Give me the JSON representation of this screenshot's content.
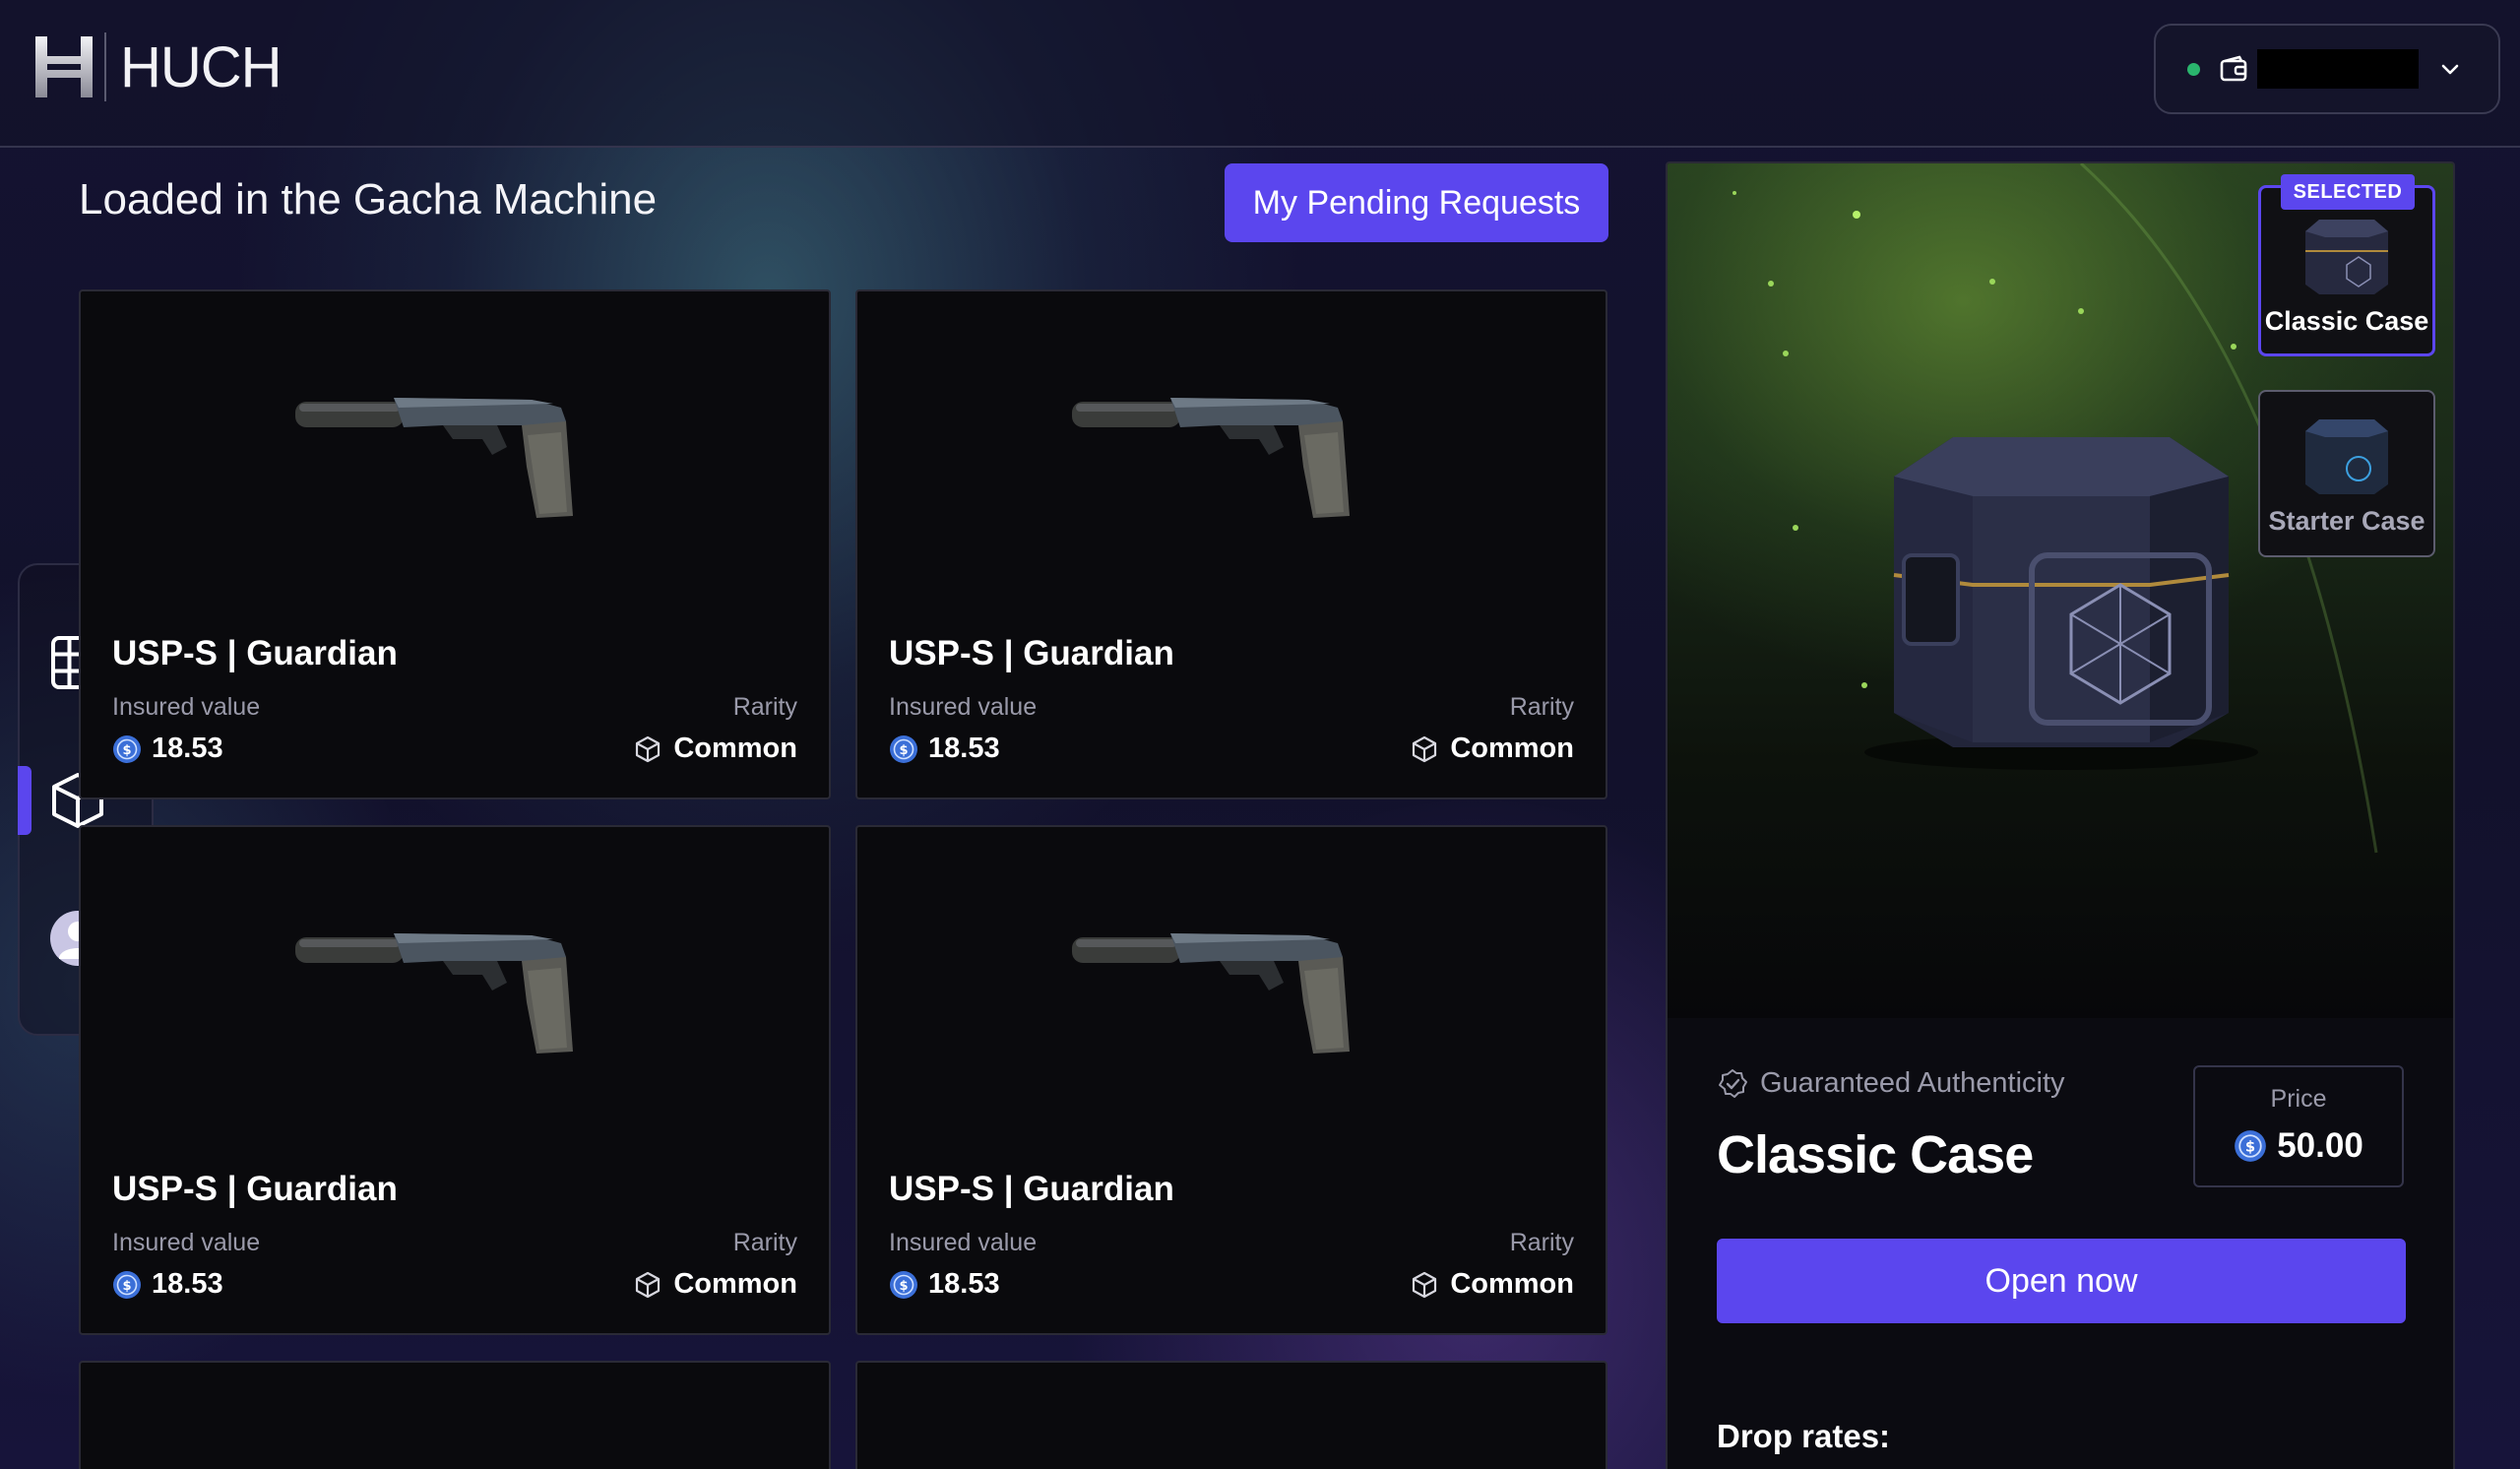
{
  "header": {
    "logo_text": "HUCH",
    "wallet": {
      "status_color": "#2ab56d",
      "address_redacted": true
    }
  },
  "nav": {
    "items": [
      {
        "icon": "grid-icon"
      },
      {
        "icon": "cube-icon",
        "active": true
      },
      {
        "icon": "user-icon"
      }
    ]
  },
  "main": {
    "title": "Loaded in the Gacha Machine",
    "pending_button": "My Pending Requests",
    "cards": [
      {
        "name": "USP-S | Guardian",
        "insured_label": "Insured value",
        "value": "18.53",
        "rarity_label": "Rarity",
        "rarity": "Common"
      },
      {
        "name": "USP-S | Guardian",
        "insured_label": "Insured value",
        "value": "18.53",
        "rarity_label": "Rarity",
        "rarity": "Common"
      },
      {
        "name": "USP-S | Guardian",
        "insured_label": "Insured value",
        "value": "18.53",
        "rarity_label": "Rarity",
        "rarity": "Common"
      },
      {
        "name": "USP-S | Guardian",
        "insured_label": "Insured value",
        "value": "18.53",
        "rarity_label": "Rarity",
        "rarity": "Common"
      }
    ]
  },
  "panel": {
    "cases": [
      {
        "name": "Classic Case",
        "selected": true,
        "badge": "SELECTED"
      },
      {
        "name": "Starter Case",
        "selected": false
      }
    ],
    "authenticity": "Guaranteed Authenticity",
    "case_name": "Classic Case",
    "price_label": "Price",
    "price": "50.00",
    "open_button": "Open now",
    "drop_rates_label": "Drop rates:"
  },
  "colors": {
    "accent": "#5b46ee",
    "coin": "#3b6fd8",
    "muted_text": "#9a9aaa"
  }
}
